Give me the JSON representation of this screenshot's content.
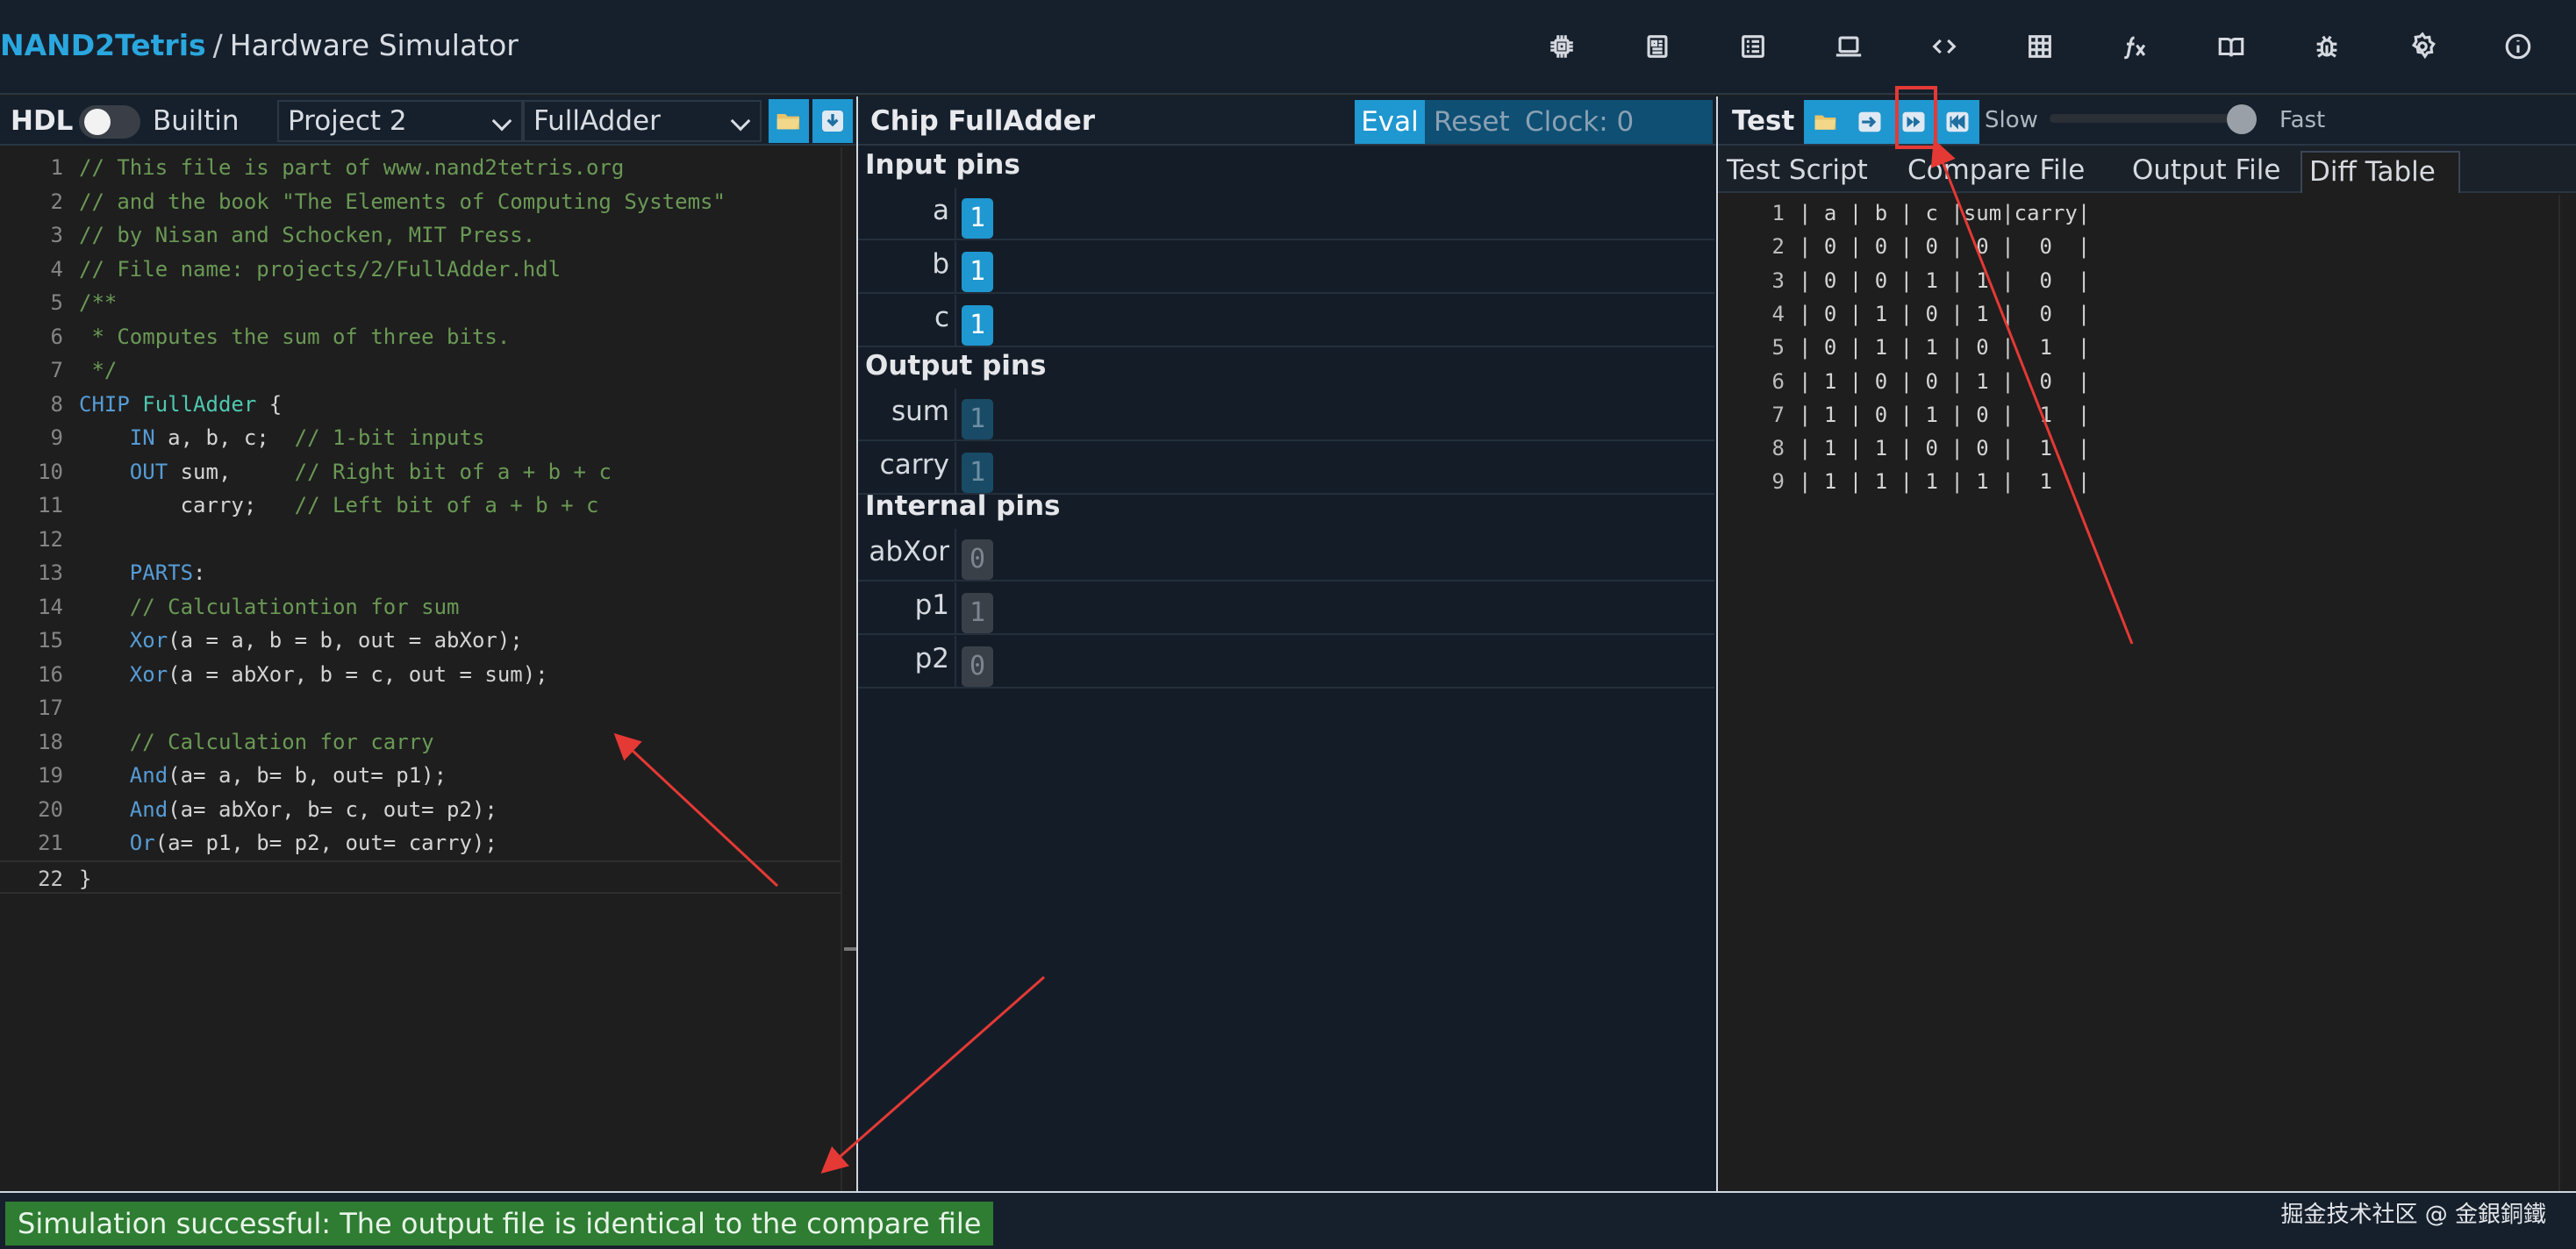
{
  "header": {
    "brand": "NAND2Tetris",
    "separator": "/",
    "title": "Hardware Simulator",
    "icons": [
      "chip-icon",
      "cpu-icon",
      "list-icon",
      "laptop-icon",
      "code-icon",
      "grid-icon",
      "function-icon",
      "book-icon",
      "bug-icon",
      "settings-icon",
      "info-icon"
    ]
  },
  "hdl": {
    "title": "HDL",
    "builtin_label": "Builtin",
    "project": "Project 2",
    "chip": "FullAdder",
    "lines": [
      [
        {
          "t": "// This file is part of www.nand2tetris.org",
          "c": "cm"
        }
      ],
      [
        {
          "t": "// and the book \"The Elements of Computing Systems\"",
          "c": "cm"
        }
      ],
      [
        {
          "t": "// by Nisan and Schocken, MIT Press.",
          "c": "cm"
        }
      ],
      [
        {
          "t": "// File name: projects/2/FullAdder.hdl",
          "c": "cm"
        }
      ],
      [
        {
          "t": "/**",
          "c": "cm"
        }
      ],
      [
        {
          "t": " * Computes the sum of three bits.",
          "c": "cm"
        }
      ],
      [
        {
          "t": " */",
          "c": "cm"
        }
      ],
      [
        {
          "t": "CHIP ",
          "c": "kw"
        },
        {
          "t": "FullAdder",
          "c": "ty"
        },
        {
          "t": " {",
          "c": ""
        }
      ],
      [
        {
          "t": "    ",
          "c": ""
        },
        {
          "t": "IN",
          "c": "kw"
        },
        {
          "t": " a, b, c;  ",
          "c": ""
        },
        {
          "t": "// 1-bit inputs",
          "c": "cm"
        }
      ],
      [
        {
          "t": "    ",
          "c": ""
        },
        {
          "t": "OUT",
          "c": "kw"
        },
        {
          "t": " sum,     ",
          "c": ""
        },
        {
          "t": "// Right bit of a + b + c",
          "c": "cm"
        }
      ],
      [
        {
          "t": "        carry;   ",
          "c": ""
        },
        {
          "t": "// Left bit of a + b + c",
          "c": "cm"
        }
      ],
      [
        {
          "t": "",
          "c": ""
        }
      ],
      [
        {
          "t": "    ",
          "c": ""
        },
        {
          "t": "PARTS",
          "c": "kw"
        },
        {
          "t": ":",
          "c": ""
        }
      ],
      [
        {
          "t": "    ",
          "c": ""
        },
        {
          "t": "// Calculationtion for sum",
          "c": "cm"
        }
      ],
      [
        {
          "t": "    ",
          "c": ""
        },
        {
          "t": "Xor",
          "c": "kw"
        },
        {
          "t": "(a = a, b = b, out = abXor);",
          "c": ""
        }
      ],
      [
        {
          "t": "    ",
          "c": ""
        },
        {
          "t": "Xor",
          "c": "kw"
        },
        {
          "t": "(a = abXor, b = c, out = sum);",
          "c": ""
        }
      ],
      [
        {
          "t": "",
          "c": ""
        }
      ],
      [
        {
          "t": "    ",
          "c": ""
        },
        {
          "t": "// Calculation for carry",
          "c": "cm"
        }
      ],
      [
        {
          "t": "    ",
          "c": ""
        },
        {
          "t": "And",
          "c": "kw"
        },
        {
          "t": "(a= a, b= b, out= p1);",
          "c": ""
        }
      ],
      [
        {
          "t": "    ",
          "c": ""
        },
        {
          "t": "And",
          "c": "kw"
        },
        {
          "t": "(a= abXor, b= c, out= p2);",
          "c": ""
        }
      ],
      [
        {
          "t": "    ",
          "c": ""
        },
        {
          "t": "Or",
          "c": "kw"
        },
        {
          "t": "(a= p1, b= p2, out= carry);",
          "c": ""
        }
      ],
      [
        {
          "t": "}",
          "c": ""
        }
      ]
    ]
  },
  "chip": {
    "title": "Chip FullAdder",
    "eval_label": "Eval",
    "reset_label": "Reset",
    "clock_label": "Clock: 0",
    "input_title": "Input pins",
    "output_title": "Output pins",
    "internal_title": "Internal pins",
    "inputs": [
      {
        "name": "a",
        "value": "1"
      },
      {
        "name": "b",
        "value": "1"
      },
      {
        "name": "c",
        "value": "1"
      }
    ],
    "outputs": [
      {
        "name": "sum",
        "value": "1"
      },
      {
        "name": "carry",
        "value": "1"
      }
    ],
    "internals": [
      {
        "name": "abXor",
        "value": "0"
      },
      {
        "name": "p1",
        "value": "1"
      },
      {
        "name": "p2",
        "value": "0"
      }
    ]
  },
  "test": {
    "title": "Test",
    "slow_label": "Slow",
    "fast_label": "Fast",
    "tabs": [
      "Test Script",
      "Compare File",
      "Output File",
      "Diff Table"
    ],
    "active_tab": "Diff Table",
    "rows": [
      "| a | b | c |sum|carry|",
      "| 0 | 0 | 0 | 0 |  0  |",
      "| 0 | 0 | 1 | 1 |  0  |",
      "| 0 | 1 | 0 | 1 |  0  |",
      "| 0 | 1 | 1 | 0 |  1  |",
      "| 1 | 0 | 0 | 1 |  0  |",
      "| 1 | 0 | 1 | 0 |  1  |",
      "| 1 | 1 | 0 | 0 |  1  |",
      "| 1 | 1 | 1 | 1 |  1  |"
    ]
  },
  "status": {
    "message": "Simulation successful: The output file is identical to the compare file",
    "watermark": "掘金技术社区 @ 金銀銅鐵"
  },
  "colors": {
    "accent": "#1f97d0",
    "success": "#2e7d32",
    "annotation": "#e53935"
  }
}
